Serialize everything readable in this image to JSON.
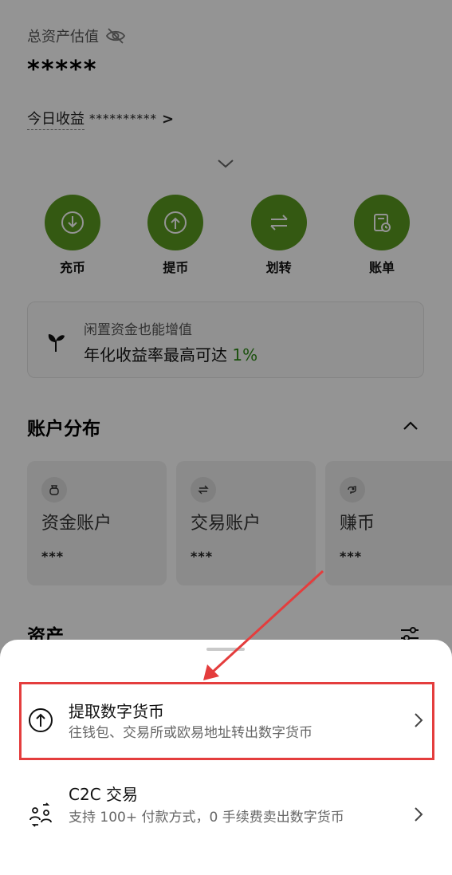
{
  "header": {
    "total_label": "总资产估值",
    "total_value": "*****",
    "today_label": "今日收益",
    "today_value": "**********",
    "today_chevron": ">"
  },
  "actions": [
    {
      "label": "充币",
      "icon": "deposit-icon"
    },
    {
      "label": "提币",
      "icon": "withdraw-icon"
    },
    {
      "label": "划转",
      "icon": "transfer-icon"
    },
    {
      "label": "账单",
      "icon": "bill-icon"
    }
  ],
  "promo": {
    "line1": "闲置资金也能增值",
    "line2_prefix": "年化收益率最高可达 ",
    "line2_rate": "1%"
  },
  "distribution": {
    "title": "账户分布",
    "cards": [
      {
        "name": "资金账户",
        "value": "***",
        "icon": "wallet-bag-icon"
      },
      {
        "name": "交易账户",
        "value": "***",
        "icon": "swap-icon"
      },
      {
        "name": "赚币",
        "value": "***",
        "icon": "earn-icon"
      }
    ]
  },
  "assets": {
    "title": "资产"
  },
  "sheet": {
    "options": [
      {
        "title": "提取数字货币",
        "desc": "往钱包、交易所或欧易地址转出数字货币",
        "icon": "withdraw-circle-icon"
      },
      {
        "title": "C2C 交易",
        "desc": "支持 100+ 付款方式，0 手续费卖出数字货币",
        "icon": "c2c-users-icon"
      }
    ]
  },
  "colors": {
    "brand_green": "#5a9a1f",
    "highlight_green": "#2d8a16",
    "annotation_red": "#e43d3d"
  }
}
